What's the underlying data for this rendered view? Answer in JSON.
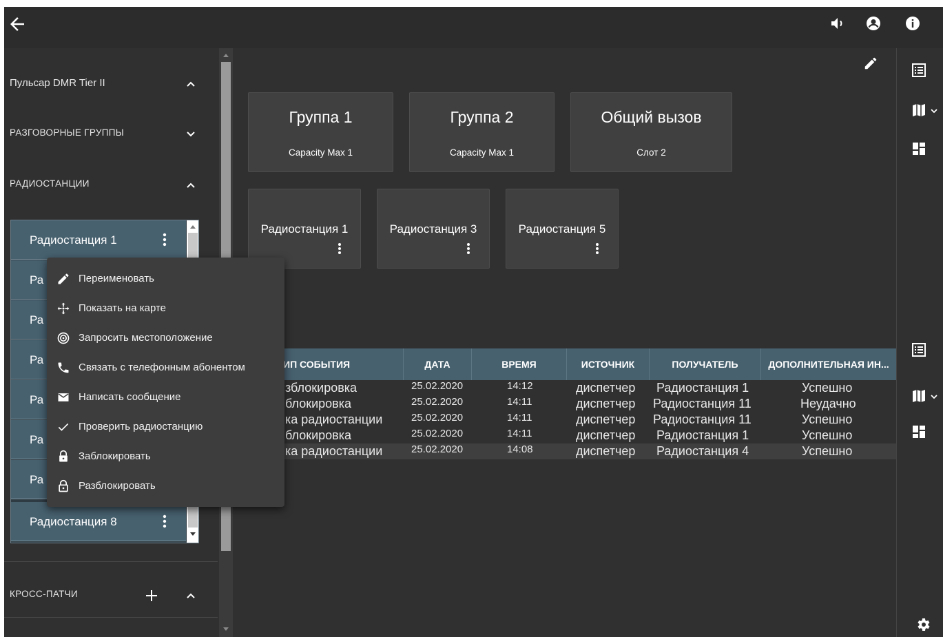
{
  "topbar": {
    "back_icon": "arrow-left-icon",
    "icons": [
      "volume-icon",
      "account-icon",
      "info-icon"
    ]
  },
  "sidebar": {
    "device": "Пульсар DMR Tier II",
    "talkgroups": "РАЗГОВОРНЫЕ ГРУППЫ",
    "radios": "РАДИОСТАНЦИИ",
    "crosspatch": "КРОСС-ПАТЧИ",
    "radio_items": [
      {
        "label": "Радиостанция 1"
      },
      {
        "label": "Ра"
      },
      {
        "label": "Ра"
      },
      {
        "label": "Ра"
      },
      {
        "label": "Ра"
      },
      {
        "label": "Ра"
      },
      {
        "label": "Ра"
      },
      {
        "label": "Радиостанция 8"
      }
    ]
  },
  "context_menu": {
    "items": [
      {
        "label": "Переименовать",
        "icon": "pencil-icon"
      },
      {
        "label": "Показать на карте",
        "icon": "move-icon"
      },
      {
        "label": "Запросить местоположение",
        "icon": "location-request-icon"
      },
      {
        "label": "Связать с телефонным абонентом",
        "icon": "phone-icon"
      },
      {
        "label": "Написать сообщение",
        "icon": "message-icon"
      },
      {
        "label": "Проверить радиостанцию",
        "icon": "check-icon"
      },
      {
        "label": "Заблокировать",
        "icon": "lock-icon"
      },
      {
        "label": "Разблокировать",
        "icon": "unlock-icon"
      }
    ]
  },
  "groups": [
    {
      "title": "Группа 1",
      "subtitle": "Capacity Max 1"
    },
    {
      "title": "Группа 2",
      "subtitle": "Capacity Max 1"
    },
    {
      "title": "Общий вызов",
      "subtitle": "Слот 2"
    }
  ],
  "radio_cards": [
    {
      "title": "Радиостанция 1"
    },
    {
      "title": "Радиостанция 3"
    },
    {
      "title": "Радиостанция 5"
    }
  ],
  "events_table": {
    "columns": [
      "ИП СОБЫТИЯ",
      "ДАТА",
      "ВРЕМЯ",
      "ИСТОЧНИК",
      "ПОЛУЧАТЕЛЬ",
      "ДОПОЛНИТЕЛЬНАЯ ИН..."
    ],
    "rows": [
      [
        "зблокировка",
        "25.02.2020",
        "14:12",
        "диспетчер",
        "Радиостанция 1",
        "Успешно"
      ],
      [
        "блокировка",
        "25.02.2020",
        "14:11",
        "диспетчер",
        "Радиостанция 11",
        "Неудачно"
      ],
      [
        "ка радиостанции",
        "25.02.2020",
        "14:11",
        "диспетчер",
        "Радиостанция 11",
        "Успешно"
      ],
      [
        "блокировка",
        "25.02.2020",
        "14:11",
        "диспетчер",
        "Радиостанция 1",
        "Успешно"
      ],
      [
        "ка радиостанции",
        "25.02.2020",
        "14:08",
        "диспетчер",
        "Радиостанция 4",
        "Успешно"
      ]
    ]
  },
  "rail": {
    "icons": [
      "list-icon",
      "map-icon",
      "dashboard-icon",
      "list-icon",
      "map-icon",
      "dashboard-icon",
      "settings-icon"
    ]
  },
  "colors": {
    "background": "#303030",
    "accent": "#47616f",
    "card": "#404040",
    "menu": "#3d3d3d"
  }
}
